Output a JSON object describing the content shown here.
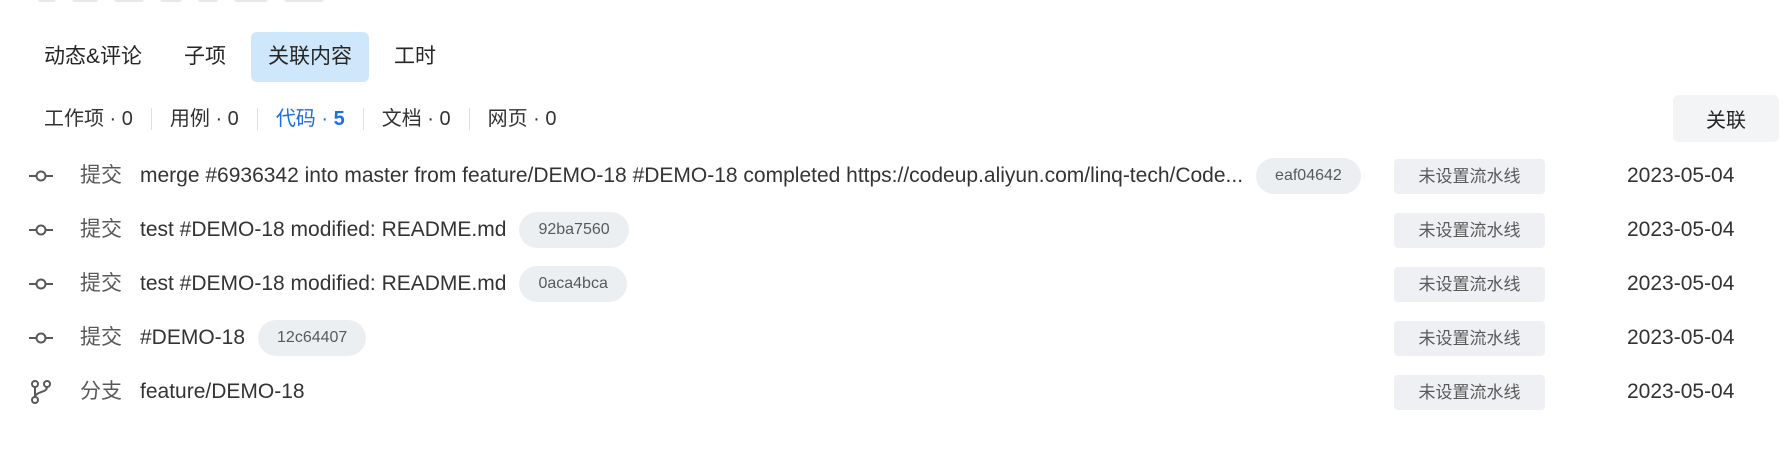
{
  "tabs": [
    {
      "label": "动态&评论",
      "active": false
    },
    {
      "label": "子项",
      "active": false
    },
    {
      "label": "关联内容",
      "active": true
    },
    {
      "label": "工时",
      "active": false
    }
  ],
  "filters": [
    {
      "label": "工作项 · 0"
    },
    {
      "label": "用例 · 0"
    },
    {
      "label": "代码 · ",
      "count": "5",
      "active": true
    },
    {
      "label": "文档 · 0"
    },
    {
      "label": "网页 · 0"
    }
  ],
  "link_button_label": "关联",
  "rows": [
    {
      "icon": "commit-icon",
      "type": "提交",
      "title": "merge #6936342 into master from feature/DEMO-18 #DEMO-18 completed https://codeup.aliyun.com/linq-tech/Code...",
      "hash": "eaf04642",
      "pipeline": "未设置流水线",
      "date": "2023-05-04"
    },
    {
      "icon": "commit-icon",
      "type": "提交",
      "title": "test #DEMO-18 modified: README.md",
      "hash": "92ba7560",
      "pipeline": "未设置流水线",
      "date": "2023-05-04"
    },
    {
      "icon": "commit-icon",
      "type": "提交",
      "title": "test #DEMO-18 modified: README.md",
      "hash": "0aca4bca",
      "pipeline": "未设置流水线",
      "date": "2023-05-04"
    },
    {
      "icon": "commit-icon",
      "type": "提交",
      "title": "#DEMO-18",
      "hash": "12c64407",
      "pipeline": "未设置流水线",
      "date": "2023-05-04"
    },
    {
      "icon": "branch-icon",
      "type": "分支",
      "title": "feature/DEMO-18",
      "pipeline": "未设置流水线",
      "date": "2023-05-04"
    }
  ]
}
